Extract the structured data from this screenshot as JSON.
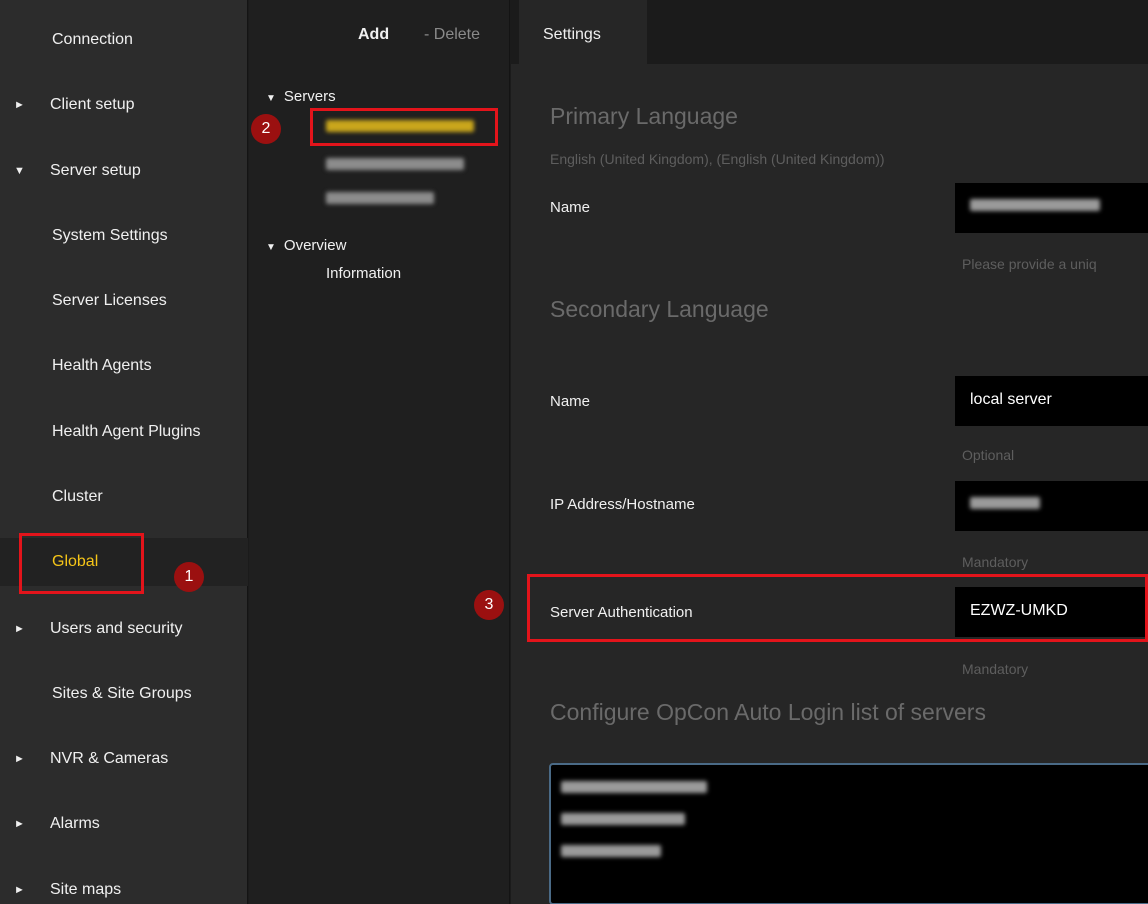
{
  "nav": {
    "items": [
      {
        "label": "Connection",
        "arrow": ""
      },
      {
        "label": "Client setup",
        "arrow": "►"
      },
      {
        "label": "Server setup",
        "arrow": "▼"
      },
      {
        "label": "System Settings",
        "arrow": ""
      },
      {
        "label": "Server Licenses",
        "arrow": ""
      },
      {
        "label": "Health Agents",
        "arrow": ""
      },
      {
        "label": "Health Agent Plugins",
        "arrow": ""
      },
      {
        "label": "Cluster",
        "arrow": ""
      },
      {
        "label": "Global",
        "arrow": ""
      },
      {
        "label": "Users and security",
        "arrow": "►"
      },
      {
        "label": "Sites & Site Groups",
        "arrow": ""
      },
      {
        "label": "NVR & Cameras",
        "arrow": "►"
      },
      {
        "label": "Alarms",
        "arrow": "►"
      },
      {
        "label": "Site maps",
        "arrow": "►"
      }
    ]
  },
  "toolbar": {
    "add_label": "Add",
    "delete_label": "- Delete"
  },
  "tree": {
    "servers_label": "Servers",
    "overview_label": "Overview",
    "information_label": "Information",
    "expanded_glyph": "▼"
  },
  "tabs": {
    "settings": "Settings"
  },
  "settings": {
    "primary_heading": "Primary Language",
    "primary_language_value": "English (United Kingdom), (English (United Kingdom))",
    "name_label": "Name",
    "name_hint": "Please provide a uniq",
    "secondary_heading": "Secondary Language",
    "secondary_name_label": "Name",
    "secondary_name_value": "local server",
    "optional_hint": "Optional",
    "ip_label": "IP Address/Hostname",
    "mandatory_hint_1": "Mandatory",
    "auth_label": "Server Authentication",
    "auth_value": "EZWZ-UMKD",
    "mandatory_hint_2": "Mandatory",
    "autologin_heading": "Configure OpCon Auto Login list of servers"
  },
  "annotations": {
    "badge_1": "1",
    "badge_2": "2",
    "badge_3": "3"
  },
  "colors": {
    "highlight_red": "#e3141b",
    "badge_red": "#9b1010",
    "active_yellow": "#f5c518"
  }
}
